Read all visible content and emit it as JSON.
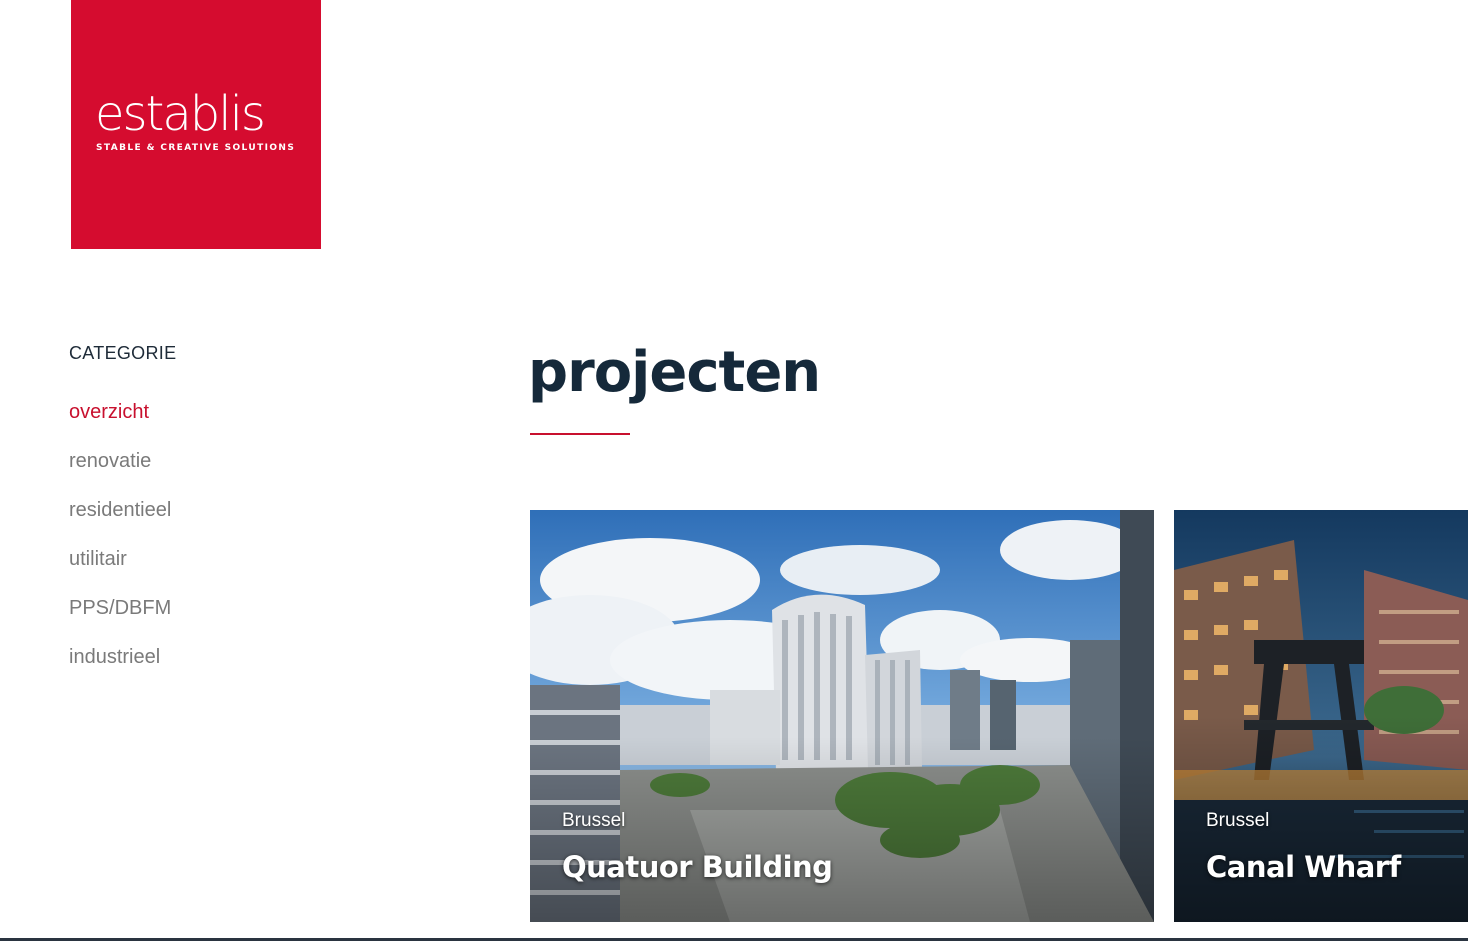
{
  "logo": {
    "wordmark": "establis",
    "tagline": "STABLE & CREATIVE SOLUTIONS",
    "color": "#d50c2f"
  },
  "sidebar": {
    "title": "CATEGORIE",
    "items": [
      {
        "label": "overzicht",
        "active": true
      },
      {
        "label": "renovatie",
        "active": false
      },
      {
        "label": "residentieel",
        "active": false
      },
      {
        "label": "utilitair",
        "active": false
      },
      {
        "label": "PPS/DBFM",
        "active": false
      },
      {
        "label": "industrieel",
        "active": false
      }
    ]
  },
  "main": {
    "title": "projecten",
    "accent_color": "#c8102e",
    "projects": [
      {
        "city": "Brussel",
        "name": "Quatuor Building"
      },
      {
        "city": "Brussel",
        "name": "Canal Wharf"
      }
    ]
  }
}
